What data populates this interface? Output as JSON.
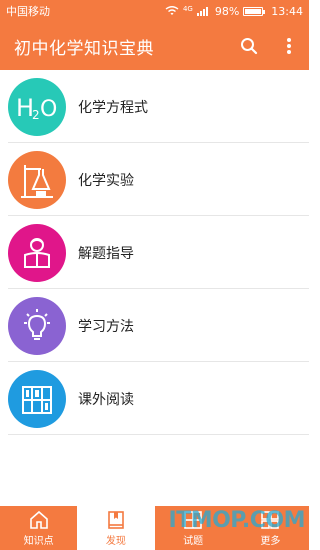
{
  "status_bar": {
    "carrier": "中国移动",
    "network": "4G",
    "battery": "98%",
    "battery_level": 0.98,
    "time": "13:44"
  },
  "app_bar": {
    "title": "初中化学知识宝典",
    "search_icon": "search-icon",
    "more_icon": "more-vertical-icon"
  },
  "list": [
    {
      "label": "化学方程式",
      "icon": "h2o-icon",
      "color": "#27c9b7",
      "icon_text_h": "H",
      "icon_text_2": "2",
      "icon_text_o": "O"
    },
    {
      "label": "化学实验",
      "icon": "lab-flask-icon",
      "color": "#f37b3f"
    },
    {
      "label": "解题指导",
      "icon": "student-reading-icon",
      "color": "#e0168a"
    },
    {
      "label": "学习方法",
      "icon": "lightbulb-icon",
      "color": "#8a63d2"
    },
    {
      "label": "课外阅读",
      "icon": "bookshelf-icon",
      "color": "#1f9be0"
    }
  ],
  "tabs": [
    {
      "label": "知识点",
      "icon": "home-icon",
      "active": false
    },
    {
      "label": "发现",
      "icon": "book-icon",
      "active": true
    },
    {
      "label": "试题",
      "icon": "grid-doc-icon",
      "active": false
    },
    {
      "label": "更多",
      "icon": "apps-icon",
      "active": false
    }
  ],
  "colors": {
    "primary": "#f47a40",
    "watermark": "#28aad2"
  },
  "watermark": "ITMOP.COM"
}
